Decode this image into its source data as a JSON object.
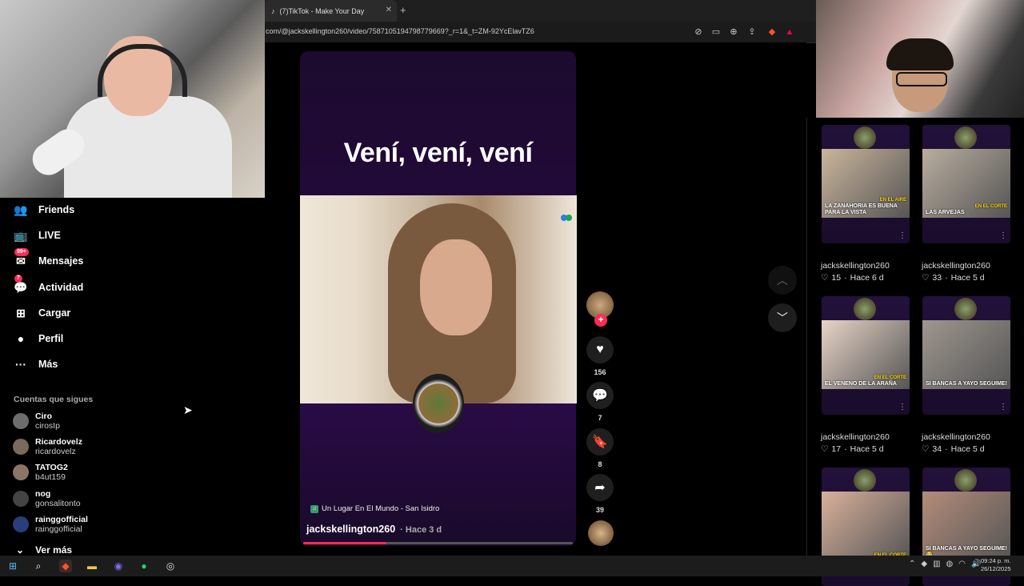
{
  "browser": {
    "tab_title": "(7)TikTok - Make Your Day",
    "tab_close": "✕",
    "new_tab": "+",
    "url": "com/@jackskellington260/video/7587105194798779669?_r=1&_t=ZM-92YcElavTZ6"
  },
  "sidebar": {
    "items": [
      {
        "label": "Friends",
        "icon": "friends-icon",
        "glyph": "👥",
        "badge": ""
      },
      {
        "label": "LIVE",
        "icon": "live-icon",
        "glyph": "📺",
        "badge": ""
      },
      {
        "label": "Mensajes",
        "icon": "messages-icon",
        "glyph": "✉",
        "badge": "99+"
      },
      {
        "label": "Actividad",
        "icon": "activity-icon",
        "glyph": "💬",
        "badge": "7"
      },
      {
        "label": "Cargar",
        "icon": "upload-icon",
        "glyph": "⊞",
        "badge": ""
      },
      {
        "label": "Perfil",
        "icon": "profile-icon",
        "glyph": "●",
        "badge": ""
      },
      {
        "label": "Más",
        "icon": "more-icon",
        "glyph": "···",
        "badge": ""
      }
    ],
    "following_title": "Cuentas que sigues",
    "accounts": [
      {
        "name": "Ciro",
        "handle": "cirosIp"
      },
      {
        "name": "Ricardovelz",
        "handle": "ricardovelz"
      },
      {
        "name": "TATOG2",
        "handle": "b4ut159"
      },
      {
        "name": "nog",
        "handle": "gonsalitonto"
      },
      {
        "name": "rainggofficial",
        "handle": "rainggofficial"
      }
    ],
    "see_more": "Ver más"
  },
  "video": {
    "caption": "Vení, vení, vení",
    "music": "Un Lugar En El Mundo - San Isidro",
    "author": "jackskellington260",
    "posted": "· Hace 3 d",
    "progress": 0.31
  },
  "actions": {
    "likes": "156",
    "comments": "7",
    "saves": "8",
    "shares": "39",
    "follow": "+"
  },
  "related": [
    {
      "user": "jackskellington260",
      "likes": "15",
      "ago": "Hace 6 d",
      "text": "LA ZANAHORIA ES BUENA PARA LA VISTA",
      "tag": "EN EL AIRE"
    },
    {
      "user": "jackskellington260",
      "likes": "33",
      "ago": "Hace 5 d",
      "text": "LAS ARVEJAS",
      "tag": "EN EL CORTE"
    },
    {
      "user": "jackskellington260",
      "likes": "17",
      "ago": "Hace 5 d",
      "text": "EL VENENO DE LA ARAÑA",
      "tag": "EN EL CORTE"
    },
    {
      "user": "jackskellington260",
      "likes": "34",
      "ago": "Hace 5 d",
      "text": "SI BANCAS A YAYO SEGUIME!",
      "tag": ""
    },
    {
      "user": "",
      "likes": "",
      "ago": "",
      "text": "",
      "tag": "EN EL CORTE"
    },
    {
      "user": "",
      "likes": "",
      "ago": "",
      "text": "SI BANCAS A YAYO SEGUIME! 😂",
      "tag": ""
    }
  ],
  "taskbar": {
    "time": "09:24 p. m.",
    "date": "26/12/2025"
  },
  "colors": {
    "accent": "#fe2c55",
    "video_bg": "#23093b"
  }
}
